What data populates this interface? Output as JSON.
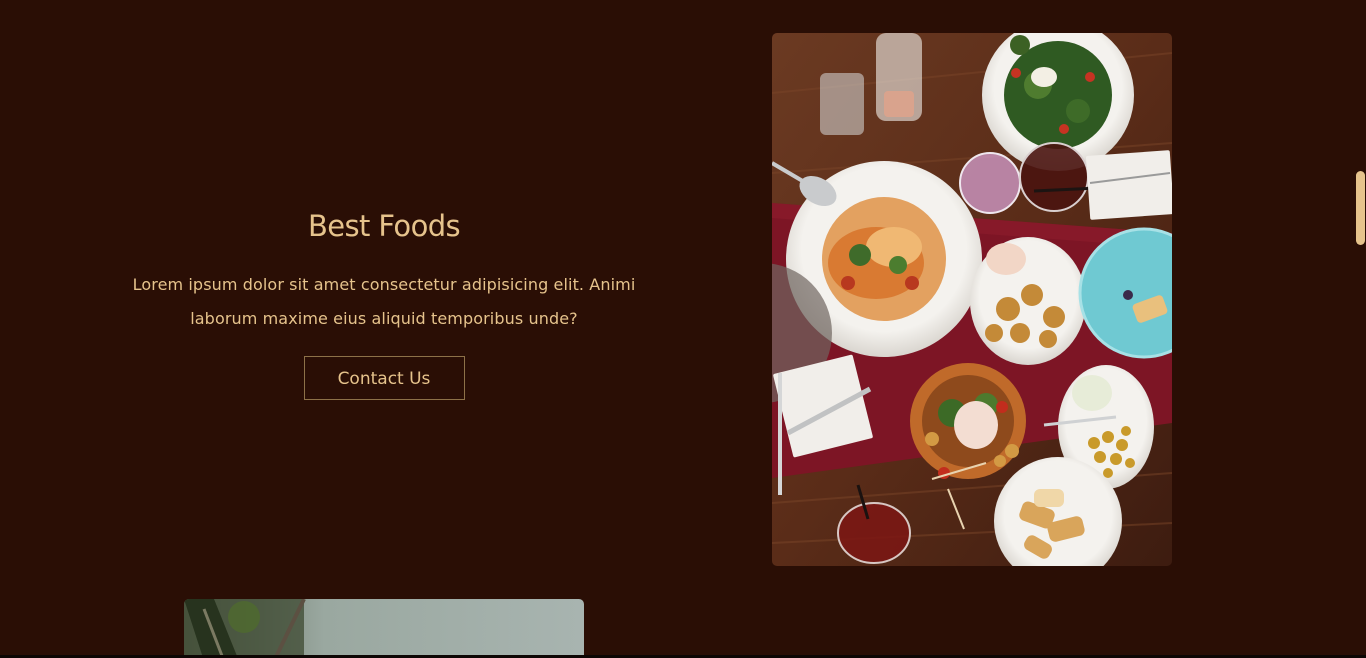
{
  "hero": {
    "title": "Best Foods",
    "description": "Lorem ipsum dolor sit amet consectetur adipisicing elit. Animi laborum maxime eius aliquid temporibus unde?",
    "button_label": "Contact Us"
  },
  "theme": {
    "background": "#2a0e05",
    "accent": "#e6c38c"
  },
  "images": {
    "feature": "food-table-photo",
    "next": "outdoor-photo"
  }
}
